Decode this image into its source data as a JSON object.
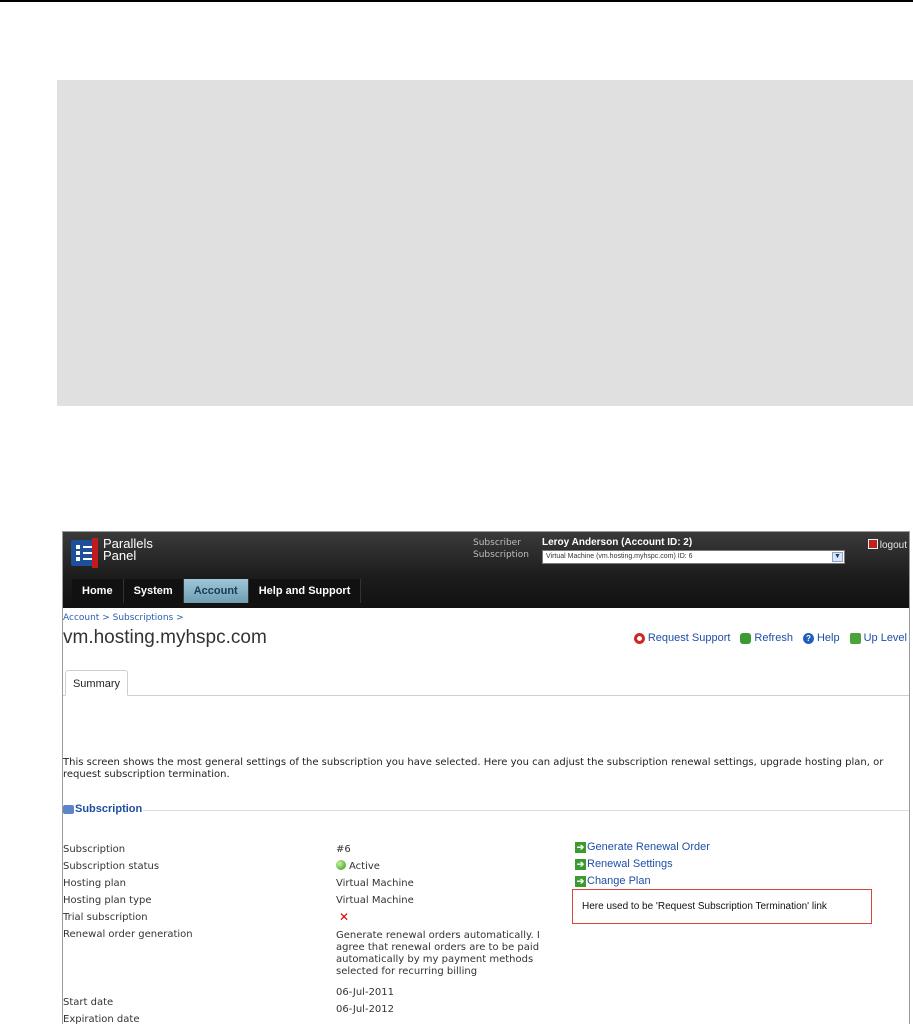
{
  "header": {
    "logo_line1": "Parallels",
    "logo_line2": "Panel",
    "subscriber_label": "Subscriber",
    "subscription_label": "Subscription",
    "subscriber_name": "Leroy Anderson (Account ID: 2)",
    "subscription_select": "Virtual Machine (vm.hosting.myhspc.com) ID: 6",
    "logout": "logout"
  },
  "nav": {
    "tabs": [
      {
        "label": "Home"
      },
      {
        "label": "System"
      },
      {
        "label": "Account"
      },
      {
        "label": "Help and Support"
      }
    ],
    "active": "Account"
  },
  "breadcrumb": "Account > Subscriptions >",
  "page_title": "vm.hosting.myhspc.com",
  "toolbar": {
    "request_support": "Request Support",
    "refresh": "Refresh",
    "help": "Help",
    "up_level": "Up Level"
  },
  "tab": "Summary",
  "description": "This screen shows the most general settings of the subscription you have selected. Here you can adjust the subscription renewal settings, upgrade hosting plan, or request subscription termination.",
  "section_title": "Subscription",
  "fields": [
    {
      "label": "Subscription",
      "value": "#6"
    },
    {
      "label": "Subscription status",
      "value": "Active"
    },
    {
      "label": "Hosting plan",
      "value": "Virtual Machine"
    },
    {
      "label": "Hosting plan type",
      "value": "Virtual Machine"
    },
    {
      "label": "Trial subscription",
      "value": "✕"
    },
    {
      "label": "Renewal order generation",
      "value": "Generate renewal orders automatically. I agree that renewal orders are to be paid automatically by my payment methods selected for recurring billing"
    },
    {
      "label": "Start date",
      "value": "06-Jul-2011"
    },
    {
      "label": "Expiration date",
      "value": "06-Jul-2012"
    }
  ],
  "actions": [
    {
      "label": "Generate Renewal Order"
    },
    {
      "label": "Renewal Settings"
    },
    {
      "label": "Change Plan"
    }
  ],
  "note": "Here used to be 'Request Subscription Termination' link"
}
